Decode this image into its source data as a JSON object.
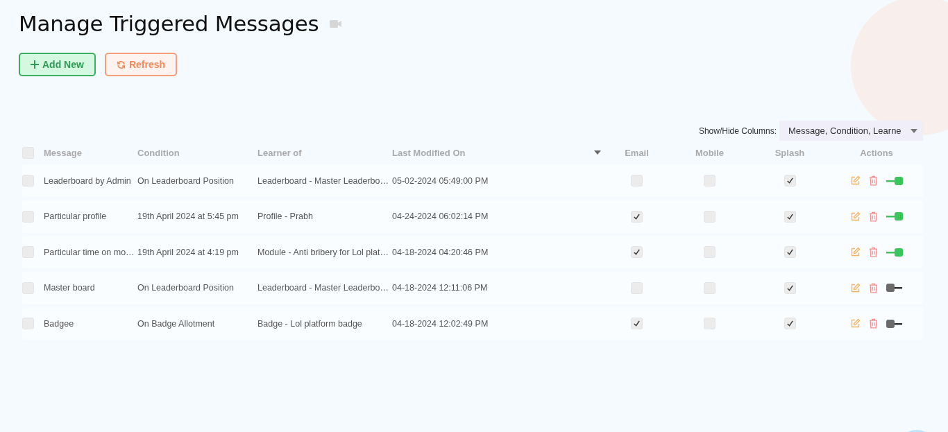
{
  "title": "Manage Triggered Messages",
  "buttons": [
    {
      "kind": "add",
      "label": "Add New"
    },
    {
      "kind": "refresh",
      "label": "Refresh"
    }
  ],
  "column_picker": {
    "label": "Show/Hide Columns:",
    "value": "Message, Condition, Learne"
  },
  "table": {
    "select_all_checked": false,
    "columns": [
      "Message",
      "Condition",
      "Learner of",
      "Last Modified On",
      "Email",
      "Mobile",
      "Splash",
      "Actions"
    ],
    "rows": [
      {
        "selected": false,
        "message": "Leaderboard by Admin",
        "condition": "On Leaderboard Position",
        "learner_of": "Leaderboard - Master Leaderbo…",
        "modified": "05-02-2024 05:49:00 PM",
        "email": false,
        "mobile": false,
        "splash": true,
        "on": true
      },
      {
        "selected": false,
        "message": "Particular profile",
        "condition": "19th April 2024 at 5:45 pm",
        "learner_of": "Profile - Prabh",
        "modified": "04-24-2024 06:02:14 PM",
        "email": true,
        "mobile": false,
        "splash": true,
        "on": true
      },
      {
        "selected": false,
        "message": "Particular time on mo…",
        "condition": "19th April 2024 at 4:19 pm",
        "learner_of": "Module - Anti bribery for Lol plat…",
        "modified": "04-18-2024 04:20:46 PM",
        "email": true,
        "mobile": false,
        "splash": true,
        "on": true
      },
      {
        "selected": false,
        "message": "Master board",
        "condition": "On Leaderboard Position",
        "learner_of": "Leaderboard - Master Leaderbo…",
        "modified": "04-18-2024 12:11:06 PM",
        "email": false,
        "mobile": false,
        "splash": true,
        "on": false
      },
      {
        "selected": false,
        "message": "Badgee",
        "condition": "On Badge Allotment",
        "learner_of": "Badge - Lol platform badge",
        "modified": "04-18-2024 12:02:49 PM",
        "email": true,
        "mobile": false,
        "splash": true,
        "on": false
      }
    ]
  }
}
